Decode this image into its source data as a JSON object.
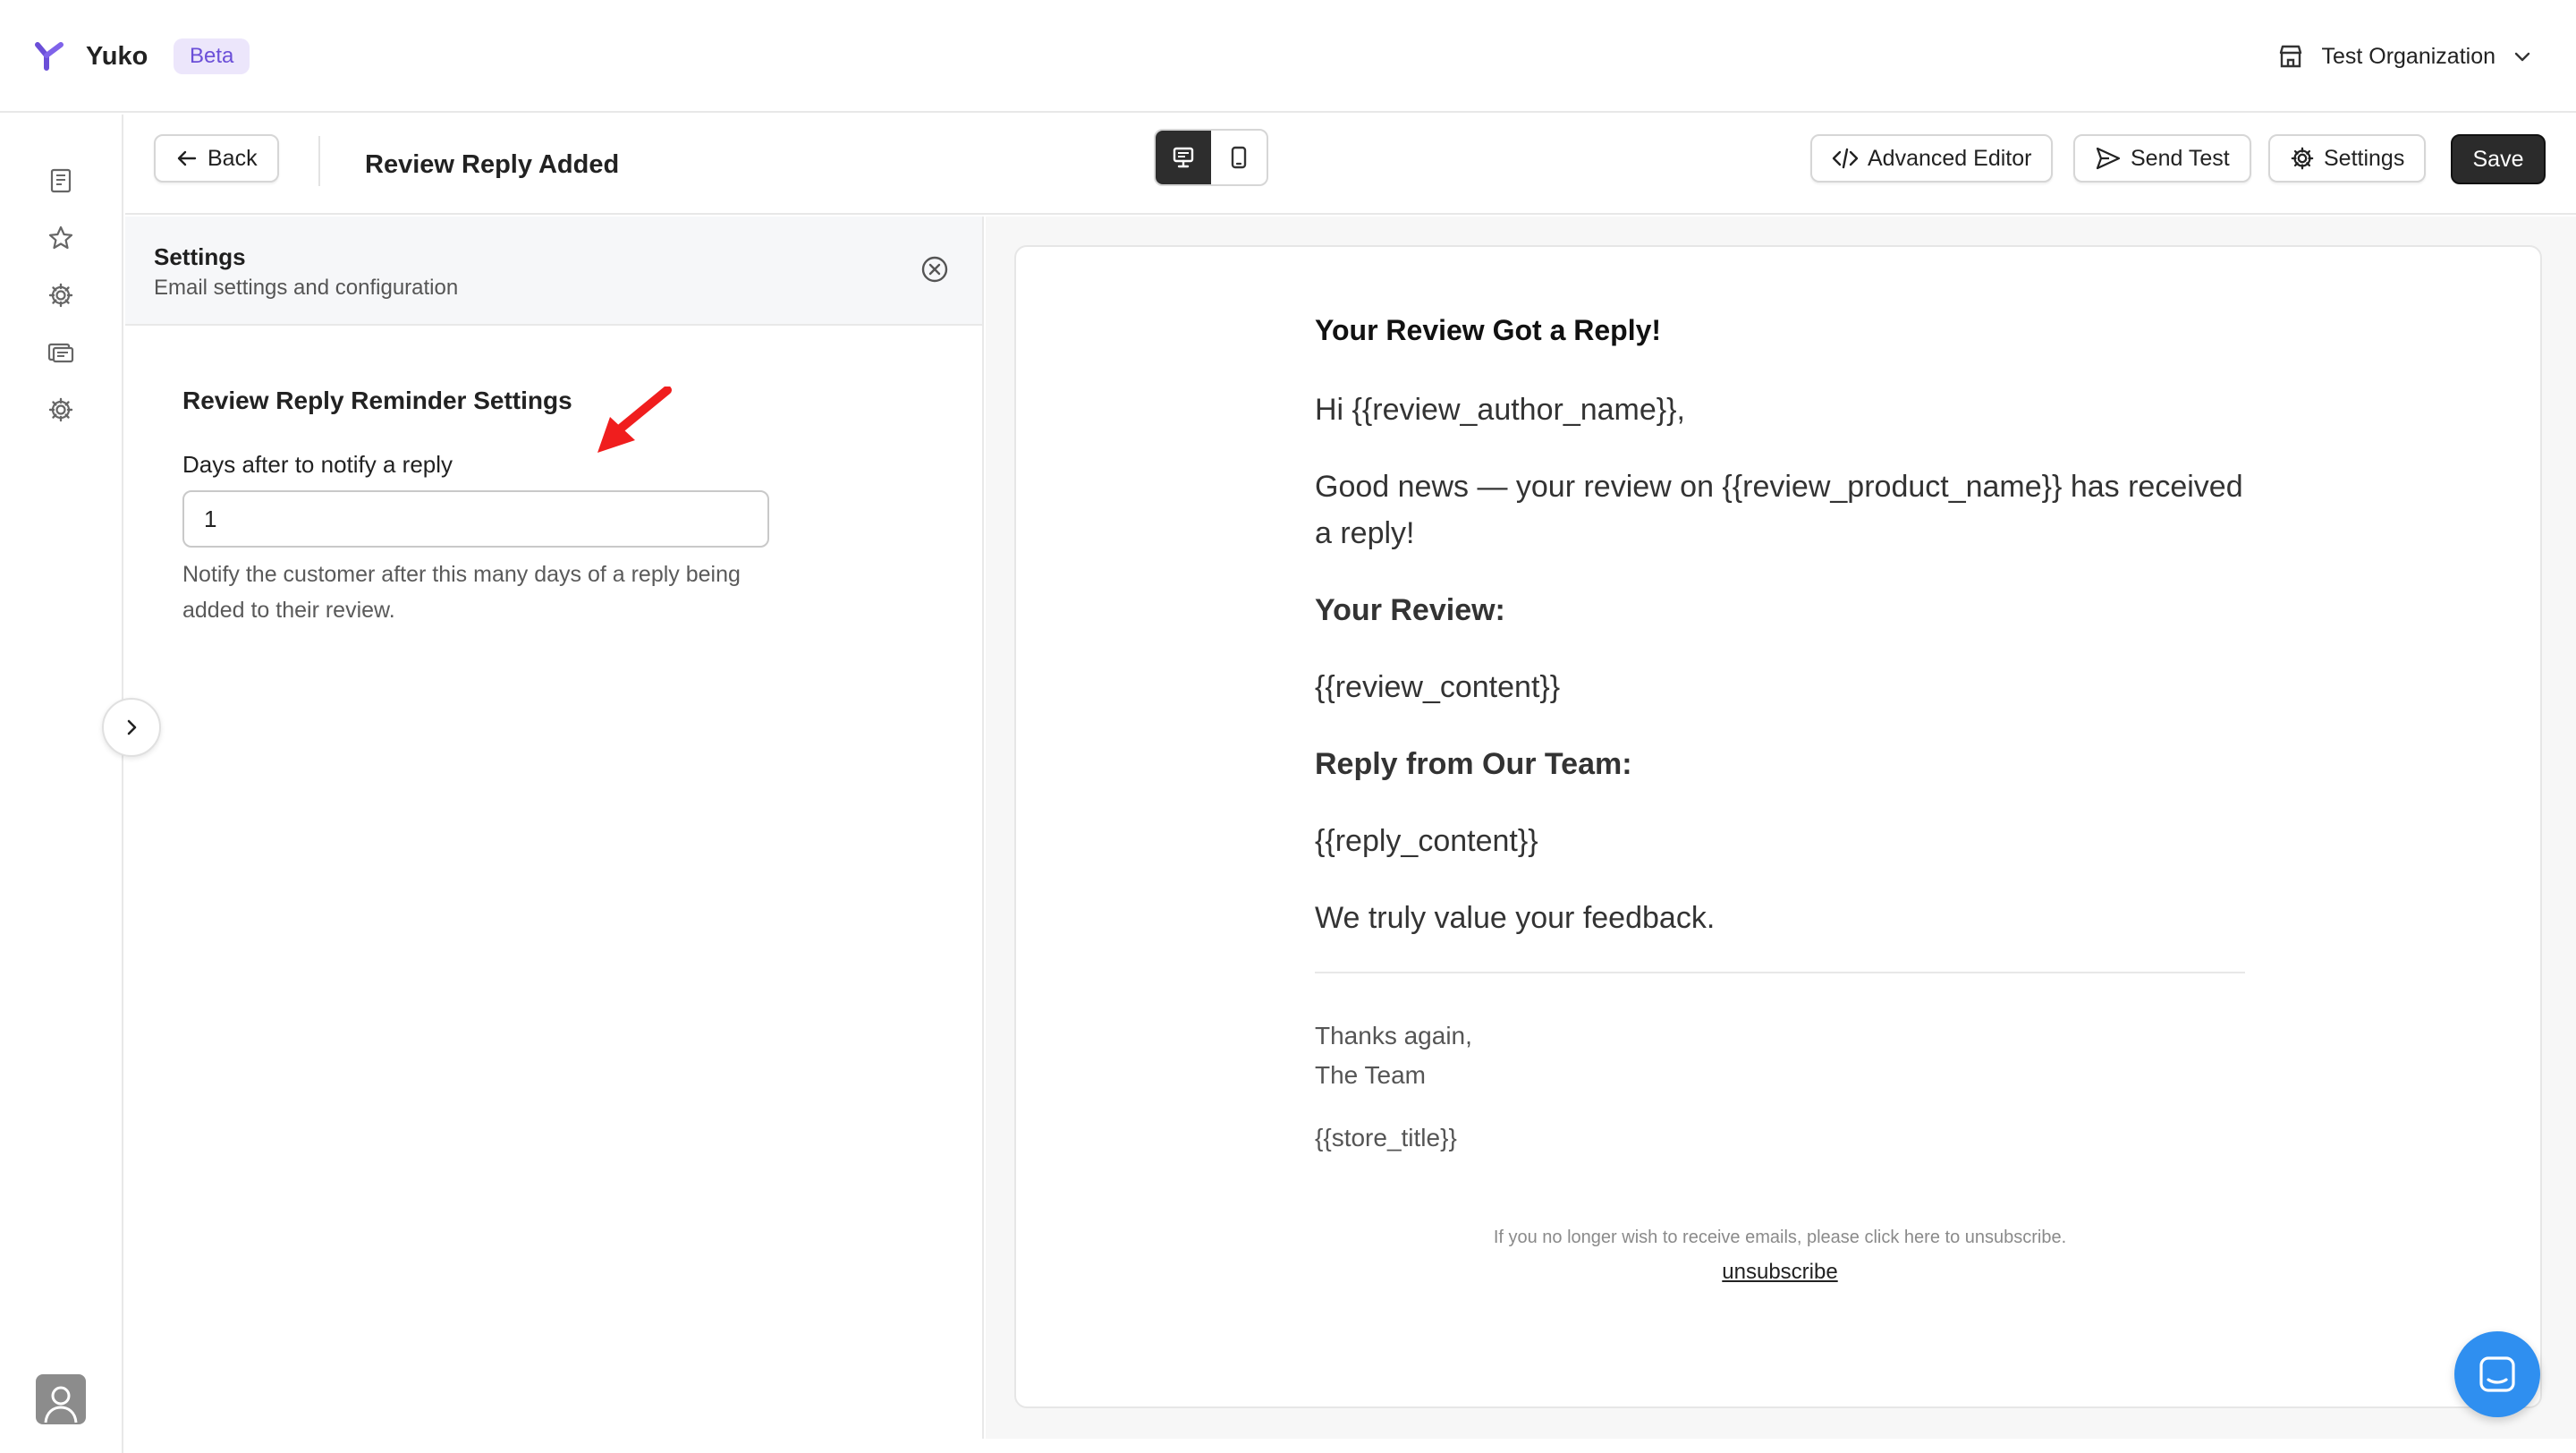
{
  "app": {
    "name": "Yuko",
    "badge": "Beta",
    "organization": "Test Organization"
  },
  "toolbar": {
    "back_label": "Back",
    "title": "Review Reply Added",
    "view_modes": [
      "desktop-icon",
      "mobile-icon"
    ],
    "active_view": "desktop",
    "advanced_editor_label": "Advanced Editor",
    "send_test_label": "Send Test",
    "settings_label": "Settings",
    "save_label": "Save"
  },
  "rail": {
    "icons": [
      "book-icon",
      "star-icon",
      "gear-icon",
      "cards-icon",
      "gear-icon"
    ]
  },
  "panel": {
    "title": "Settings",
    "subtitle": "Email settings and configuration",
    "section_title": "Review Reply Reminder Settings",
    "field": {
      "label": "Days after to notify a reply",
      "value": "1",
      "help": "Notify the customer after this many days of a reply being added to their review."
    }
  },
  "email": {
    "heading": "Your Review Got a Reply!",
    "greeting": "Hi {{review_author_name}},",
    "intro": "Good news — your review on {{review_product_name}} has received a reply!",
    "review_heading": "Your Review:",
    "review_content": "{{review_content}}",
    "reply_heading": "Reply from Our Team:",
    "reply_content": "{{reply_content}}",
    "closing": "We truly value your feedback.",
    "sign_line1": "Thanks again,",
    "sign_line2": "The Team",
    "store": "{{store_title}}",
    "footer_note": "If you no longer wish to receive emails, please click here to unsubscribe.",
    "unsubscribe": "unsubscribe"
  },
  "colors": {
    "brand": "#6b4fd8",
    "save_bg": "#2b2b2b",
    "annotation_arrow": "#f01e1e",
    "chat": "#2f8ff0"
  }
}
